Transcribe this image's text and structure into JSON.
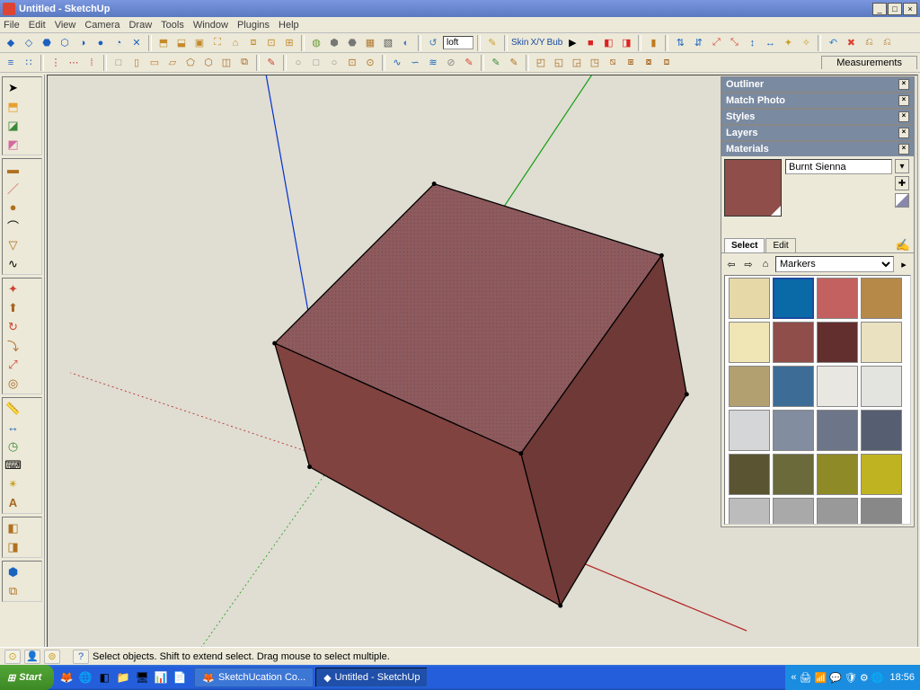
{
  "window": {
    "title": "Untitled - SketchUp"
  },
  "menu": [
    "File",
    "Edit",
    "View",
    "Camera",
    "Draw",
    "Tools",
    "Window",
    "Plugins",
    "Help"
  ],
  "toolbar_row1": {
    "loft_label": "loft",
    "skin": "Skin",
    "xy": "X/Y",
    "bub": "Bub",
    "measurements": "Measurements"
  },
  "panels": {
    "outliner": "Outliner",
    "match_photo": "Match Photo",
    "styles": "Styles",
    "layers": "Layers",
    "materials": {
      "title": "Materials",
      "current_name": "Burnt Sienna",
      "tabs": {
        "select": "Select",
        "edit": "Edit"
      },
      "library": "Markers",
      "swatches": [
        {
          "c": "#e7d8a8"
        },
        {
          "c": "#0a6aa8",
          "sel": true
        },
        {
          "c": "#c36160"
        },
        {
          "c": "#b68948"
        },
        {
          "c": "#efe5b5"
        },
        {
          "c": "#8f4e4a"
        },
        {
          "c": "#632e2e"
        },
        {
          "c": "#eae1c0"
        },
        {
          "c": "#b3a071"
        },
        {
          "c": "#3d6d96"
        },
        {
          "c": "#e9e7e2"
        },
        {
          "c": "#e3e3e0"
        },
        {
          "c": "#d5d6d8"
        },
        {
          "c": "#828da0"
        },
        {
          "c": "#6d7588"
        },
        {
          "c": "#565e72"
        },
        {
          "c": "#5a5432"
        },
        {
          "c": "#6a6a3a"
        },
        {
          "c": "#8e8a28"
        },
        {
          "c": "#c0b322"
        },
        {
          "c": "#bcbcbc"
        },
        {
          "c": "#a9a9a9"
        },
        {
          "c": "#999999"
        },
        {
          "c": "#888888"
        }
      ]
    }
  },
  "status": {
    "hint": "Select objects. Shift to extend select. Drag mouse to select multiple."
  },
  "taskbar": {
    "start": "Start",
    "apps": [
      {
        "label": "SketchUcation Co...",
        "active": false
      },
      {
        "label": "Untitled - SketchUp",
        "active": true
      }
    ],
    "clock": "18:56"
  },
  "cube": {
    "top_color": "#8f5a5c",
    "left_color": "#81433f",
    "right_color": "#6e3936"
  }
}
